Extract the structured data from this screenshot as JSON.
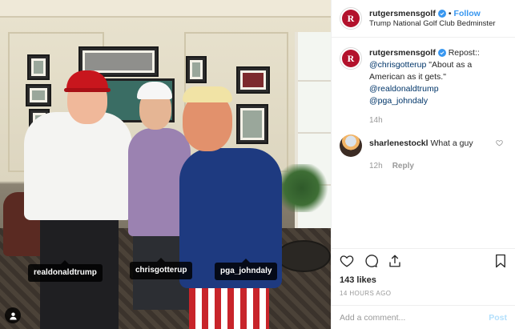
{
  "header": {
    "username": "rutgersmensgolf",
    "separator": "•",
    "follow_label": "Follow",
    "location": "Trump National Golf Club Bedminster",
    "avatar_letter": "R"
  },
  "caption": {
    "username": "rutgersmensgolf",
    "text_prefix": "Repost::",
    "mention_1": "@chrisgotterup",
    "quote": "\"About as a American as it gets.\"",
    "mention_2": "@realdonaldtrump",
    "mention_3": "@pga_johndaly",
    "age": "14h"
  },
  "comment": {
    "username": "sharlenestockl",
    "text": "What a guy",
    "age": "12h",
    "reply_label": "Reply"
  },
  "photo_tags": [
    "realdonaldtrump",
    "chrisgotterup",
    "pga_johndaly"
  ],
  "likes": "143 likes",
  "timestamp": "14 HOURS AGO",
  "add_comment": {
    "placeholder": "Add a comment...",
    "post_label": "Post"
  },
  "colors": {
    "accent_blue": "#3897f0",
    "post_disabled": "#b2dffc",
    "avatar_red": "#b3122c"
  },
  "icons": [
    "heart-icon",
    "comment-icon",
    "share-icon",
    "bookmark-icon",
    "verified-badge-icon",
    "user-tag-icon",
    "like-comment-icon"
  ]
}
